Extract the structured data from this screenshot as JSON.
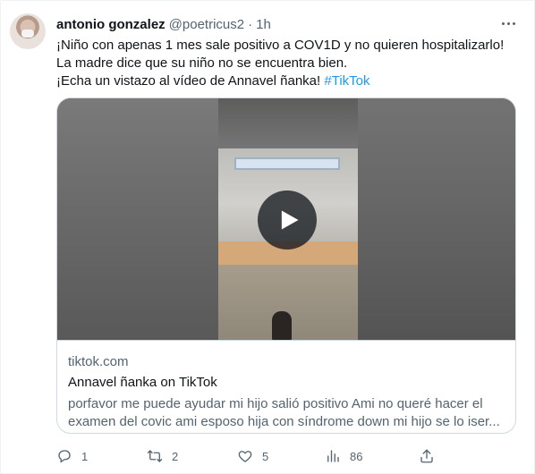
{
  "tweet": {
    "author_name": "antonio gonzalez",
    "handle": "@poetricus2",
    "separator": "·",
    "time": "1h",
    "text_lines": [
      "¡Niño con apenas 1 mes sale positivo a COV1D y no quieren hospitalizarlo!",
      "La madre dice que su niño no se encuentra bien.",
      "¡Echa un vistazo al vídeo de Annavel ñanka! "
    ],
    "hashtag": "#TikTok"
  },
  "card": {
    "domain": "tiktok.com",
    "title": "Annavel ñanka on TikTok",
    "description_lines": [
      "porfavor me puede ayudar mi hijo salió positivo Ami no queré hacer el",
      "examen del covic ami esposo hija con síndrome down mi hijo se lo iser..."
    ]
  },
  "actions": {
    "reply_count": "1",
    "retweet_count": "2",
    "like_count": "5",
    "views_count": "86"
  },
  "icons": {
    "more": "more-horizontal-icon",
    "play": "play-icon",
    "reply": "reply-icon",
    "retweet": "retweet-icon",
    "like": "heart-icon",
    "views": "analytics-icon",
    "share": "share-icon"
  },
  "colors": {
    "text_primary": "#0f1419",
    "text_secondary": "#536471",
    "link": "#1d9bf0",
    "border": "#cfd9de"
  }
}
